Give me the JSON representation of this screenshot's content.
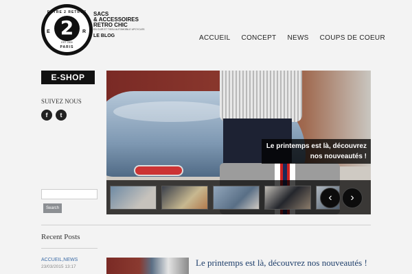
{
  "logo": {
    "ring_top": "ENTRE 2 RETROS",
    "ring_bottom": "PARIS",
    "big_number": "2",
    "left_letter": "E",
    "right_letter": "R",
    "established": "EST. 2009"
  },
  "brand": {
    "line1": "SACS",
    "line2": "& ACCESSOIRES",
    "line3": "RETRO CHIC",
    "tagline": "EN CUIR ET TISSU AUTOMOBILE UPCYCLES",
    "blog": "LE BLOG"
  },
  "nav": {
    "items": [
      {
        "label": "ACCUEIL"
      },
      {
        "label": "CONCEPT"
      },
      {
        "label": "NEWS"
      },
      {
        "label": "COUPS DE COEUR"
      }
    ]
  },
  "sidebar": {
    "eshop_label": "E-SHOP",
    "follow_label": "SUIVEZ NOUS",
    "social": [
      {
        "icon": "facebook-icon",
        "glyph": "f"
      },
      {
        "icon": "twitter-icon",
        "glyph": "t"
      }
    ],
    "search": {
      "placeholder": "",
      "button_label": "Search"
    }
  },
  "slider": {
    "caption_line1": "Le printemps est là, découvrez",
    "caption_line2": "nos nouveautés !",
    "prev_glyph": "‹",
    "next_glyph": "›"
  },
  "recent": {
    "title": "Recent Posts",
    "category": "ACCUEIL,NEWS",
    "date": "23/03/2015 13:17"
  },
  "post": {
    "title": "Le printemps est là, découvrez nos nouveautés !",
    "excerpt": ""
  },
  "colors": {
    "background": "#f3f3f3",
    "eshop_bg": "#111111",
    "post_title": "#1e3e6a",
    "category_link": "#3a6aa5"
  }
}
